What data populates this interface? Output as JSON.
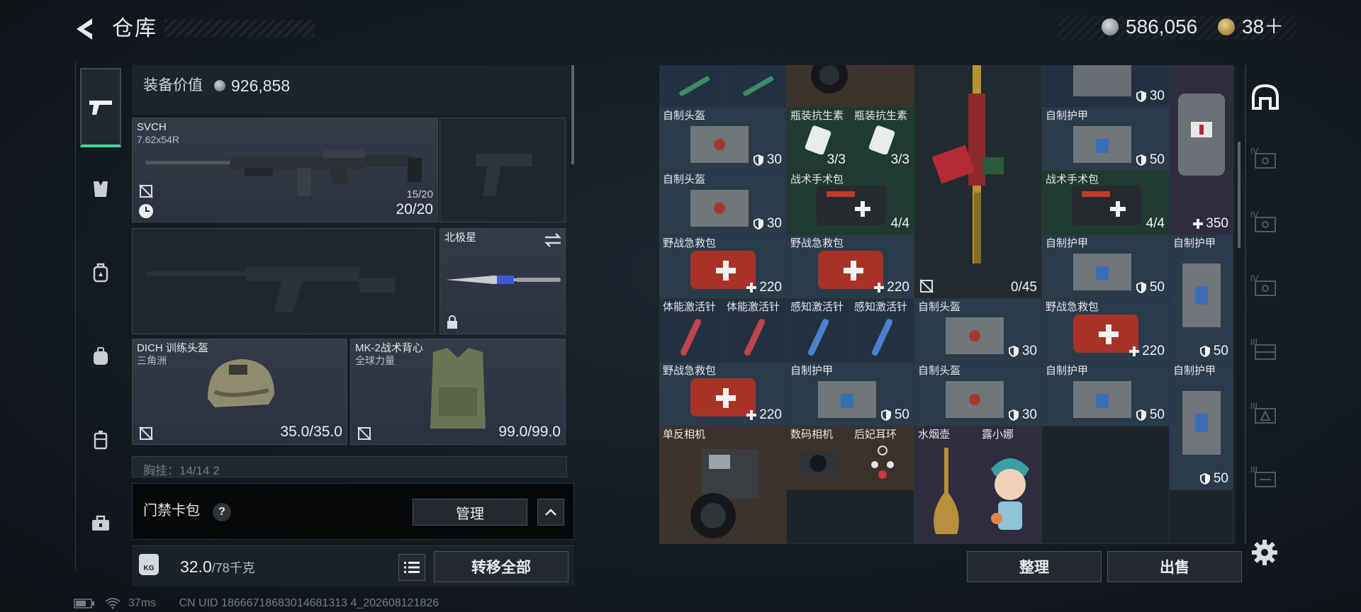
{
  "header": {
    "title": "仓库",
    "silver_amount": "586,056",
    "gold_amount": "38＋"
  },
  "equipment": {
    "value_label": "装备价值",
    "value": "926,858",
    "rifle": {
      "name": "SVCH",
      "caliber": "7.62x54R",
      "mag": "15/20",
      "ammo": "20/20"
    },
    "melee": {
      "name": "北极星"
    },
    "helmet": {
      "name": "DICH 训练头盔",
      "sub": "三角洲",
      "durability": "35.0/35.0"
    },
    "vest": {
      "name": "MK-2战术背心",
      "sub": "全球力量",
      "durability": "99.0/99.0"
    },
    "chest_rig": "胸挂：14/14  2",
    "keycard_label": "门禁卡包",
    "help": "?",
    "manage": "管理",
    "weight": "32.0",
    "weight_max": "/78千克",
    "weight_icon": "KG",
    "transfer_all": "转移全部"
  },
  "status": {
    "ping": "37ms",
    "uid": "CN UID 18666718683014681313 4_202608121826"
  },
  "warehouse": {
    "items": [
      {
        "id": "h1",
        "name": "自制头盔",
        "val": "30",
        "icon": "shield-icon"
      },
      {
        "id": "a1",
        "name": "瓶装抗生素",
        "val": "3/3",
        "icon": ""
      },
      {
        "id": "a2",
        "name": "瓶装抗生素",
        "val": "3/3",
        "icon": ""
      },
      {
        "id": "rifle",
        "name": "",
        "val": "0/45",
        "icon": ""
      },
      {
        "id": "ar_top",
        "name": "",
        "val": "30",
        "icon": "shield-icon"
      },
      {
        "id": "ar1",
        "name": "自制护甲",
        "val": "50",
        "icon": "shield-icon"
      },
      {
        "id": "pack",
        "name": "",
        "val": "350",
        "icon": "plus-icon"
      },
      {
        "id": "h2",
        "name": "自制头盔",
        "val": "30",
        "icon": "shield-icon"
      },
      {
        "id": "sk1",
        "name": "战术手术包",
        "val": "4/4",
        "icon": ""
      },
      {
        "id": "sk2",
        "name": "战术手术包",
        "val": "4/4",
        "icon": ""
      },
      {
        "id": "fk1",
        "name": "野战急救包",
        "val": "220",
        "icon": "plus-icon"
      },
      {
        "id": "fk2",
        "name": "野战急救包",
        "val": "220",
        "icon": "plus-icon"
      },
      {
        "id": "ar2",
        "name": "自制护甲",
        "val": "50",
        "icon": "shield-icon"
      },
      {
        "id": "ar3",
        "name": "自制护甲",
        "val": "50",
        "icon": "shield-icon"
      },
      {
        "id": "st1",
        "name": "体能激活针",
        "val": "",
        "icon": ""
      },
      {
        "id": "st2",
        "name": "体能激活针",
        "val": "",
        "icon": ""
      },
      {
        "id": "st3",
        "name": "感知激活针",
        "val": "",
        "icon": ""
      },
      {
        "id": "st4",
        "name": "感知激活针",
        "val": "",
        "icon": ""
      },
      {
        "id": "h3",
        "name": "自制头盔",
        "val": "30",
        "icon": "shield-icon"
      },
      {
        "id": "fk3",
        "name": "野战急救包",
        "val": "220",
        "icon": "plus-icon"
      },
      {
        "id": "fk4",
        "name": "野战急救包",
        "val": "220",
        "icon": "plus-icon"
      },
      {
        "id": "ar4",
        "name": "自制护甲",
        "val": "50",
        "icon": "shield-icon"
      },
      {
        "id": "h4",
        "name": "自制头盔",
        "val": "30",
        "icon": "shield-icon"
      },
      {
        "id": "ar5",
        "name": "自制护甲",
        "val": "50",
        "icon": "shield-icon"
      },
      {
        "id": "ar6",
        "name": "自制护甲",
        "val": "50",
        "icon": "shield-icon"
      },
      {
        "id": "cam1",
        "name": "单反相机",
        "val": "",
        "icon": ""
      },
      {
        "id": "cam2",
        "name": "数码相机",
        "val": "",
        "icon": ""
      },
      {
        "id": "ear",
        "name": "后妃耳环",
        "val": "",
        "icon": ""
      },
      {
        "id": "hook",
        "name": "水烟壶",
        "val": "",
        "icon": ""
      },
      {
        "id": "doll",
        "name": "露小娜",
        "val": "",
        "icon": ""
      }
    ],
    "sort": "整理",
    "sell": "出售",
    "side_tabs": [
      "IV",
      "IV",
      "IV",
      "III",
      "III",
      "III"
    ]
  }
}
